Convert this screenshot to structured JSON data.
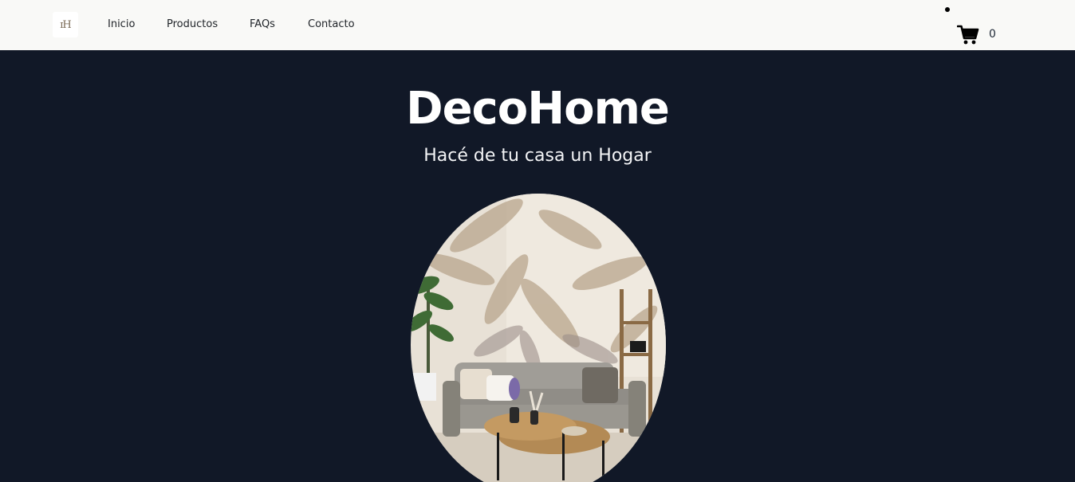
{
  "nav": {
    "logo": "ɪH",
    "links": [
      "Inicio",
      "Productos",
      "FAQs",
      "Contacto"
    ],
    "cart_count": "0"
  },
  "hero": {
    "title": "DecoHome",
    "subtitle": "Hacé de tu casa un Hogar"
  },
  "colors": {
    "nav_bg": "#f9f9f7",
    "hero_bg": "#111827",
    "text_light": "#ffffff"
  },
  "icons": [
    "shopping-cart-icon"
  ]
}
